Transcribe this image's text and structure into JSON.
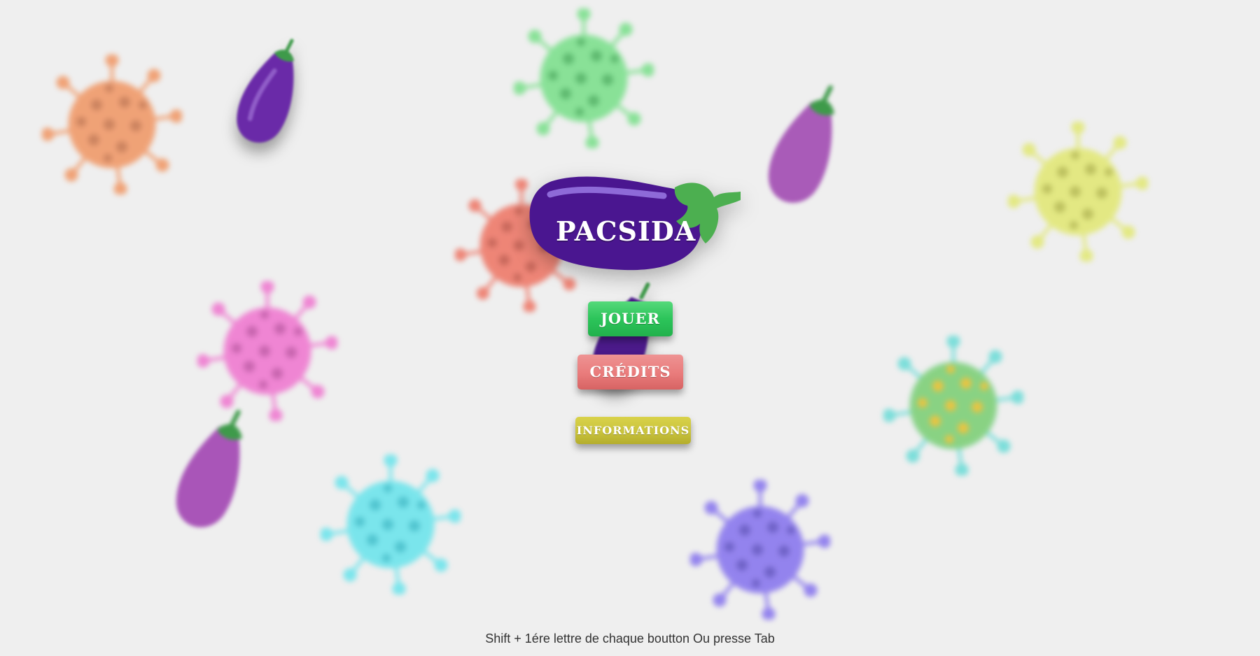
{
  "game": {
    "logo_text": "PACSIDA"
  },
  "menu": {
    "play_label": "JOUER",
    "credits_label": "CRÉDITS",
    "info_label": "INFORMATIONS"
  },
  "footer": {
    "hint": "Shift + 1ére lettre de chaque boutton Ou presse Tab"
  },
  "colors": {
    "background": "#efefef",
    "play": "#2cc45a",
    "credits": "#e97b7b",
    "info": "#c9c33c",
    "logo_purple": "#4a1690",
    "leaf_green": "#4caf50"
  },
  "decorations": {
    "viruses": [
      "orange-virus",
      "green-virus",
      "red-virus",
      "yellow-virus",
      "pink-virus",
      "teal-yellow-virus",
      "cyan-virus",
      "blue-violet-virus"
    ],
    "aubergines": [
      "dark-purple-aubergine",
      "light-purple-aubergine",
      "purple-aubergine",
      "dark-aubergine"
    ]
  }
}
